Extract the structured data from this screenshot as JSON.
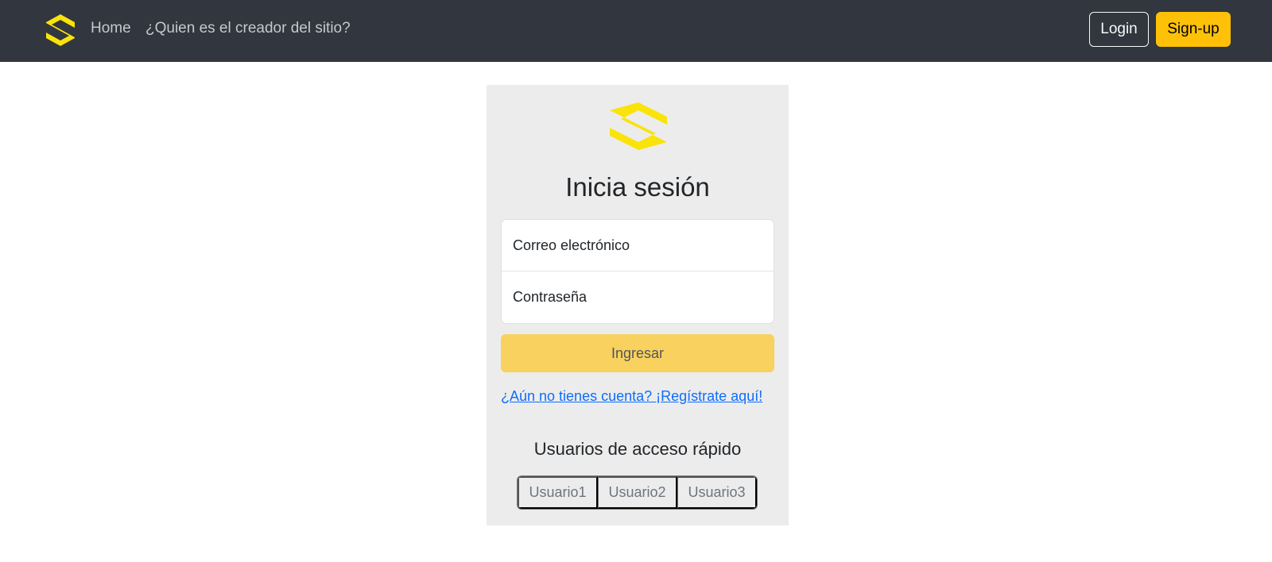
{
  "navbar": {
    "logo_icon": "s-hexagon-logo-icon",
    "home_label": "Home",
    "creator_label": "¿Quien es el creador del sitio?",
    "login_label": "Login",
    "signup_label": "Sign-up"
  },
  "login_card": {
    "logo_icon": "s-hexagon-logo-icon",
    "title": "Inicia sesión",
    "email_placeholder": "Correo electrónico",
    "password_placeholder": "Contraseña",
    "submit_label": "Ingresar",
    "register_link": "¿Aún no tienes cuenta? ¡Regístrate aquí!",
    "quick_access_title": "Usuarios de acceso rápido",
    "quick_users": [
      "Usuario1",
      "Usuario2",
      "Usuario3"
    ]
  },
  "colors": {
    "navbar_bg": "#31363f",
    "logo_yellow": "#f9e30a",
    "signup_bg": "#ffc107",
    "submit_bg": "#f8d15e",
    "card_bg": "#ececec",
    "link": "#0d6efd"
  }
}
